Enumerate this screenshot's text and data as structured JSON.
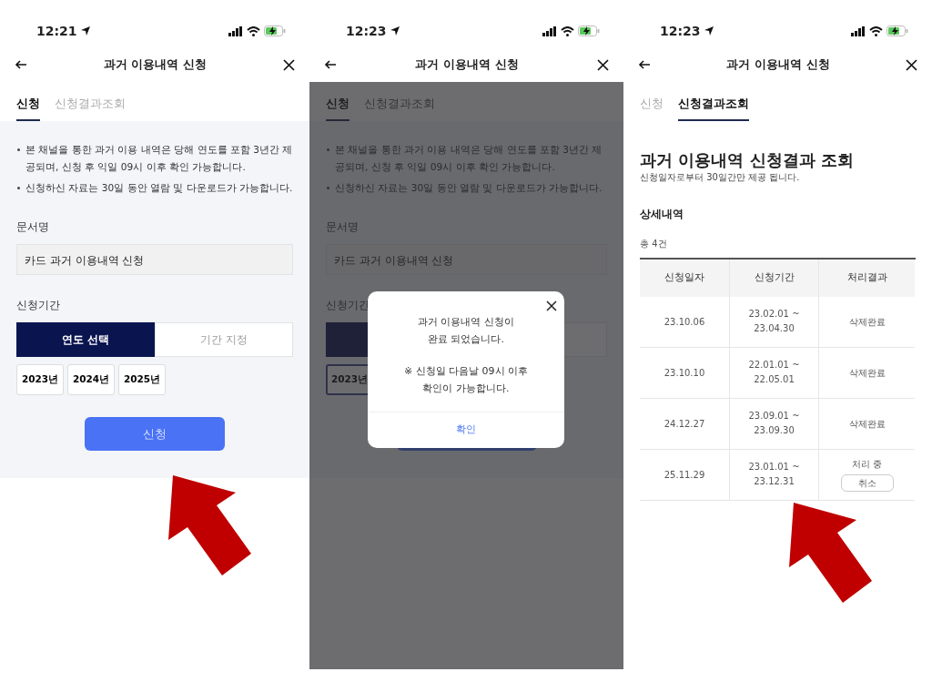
{
  "screens": [
    {
      "kind": "form",
      "status_bar": {
        "time": "12:21"
      },
      "header": {
        "title": "과거 이용내역 신청"
      },
      "tabs": [
        {
          "label": "신청",
          "selected": true
        },
        {
          "label": "신청결과조회",
          "selected": false
        }
      ],
      "notices": [
        "본 채널을 통한 과거 이용 내역은 당해 연도를 포함 3년간 제공되며, 신청 후 익일 09시 이후 확인 가능합니다.",
        "신청하신 자료는 30일 동안 열람 및 다운로드가 가능합니다."
      ],
      "document": {
        "label": "문서명",
        "value": "카드 과거 이용내역 신청"
      },
      "period": {
        "label": "신청기간",
        "modes": [
          {
            "label": "연도 선택",
            "selected": true
          },
          {
            "label": "기간 지정",
            "selected": false
          }
        ],
        "years": [
          {
            "label": "2023년",
            "selected": false
          },
          {
            "label": "2024년",
            "selected": false
          },
          {
            "label": "2025년",
            "selected": false
          }
        ]
      },
      "submit": {
        "label": "신청"
      }
    },
    {
      "kind": "form",
      "status_bar": {
        "time": "12:23"
      },
      "header": {
        "title": "과거 이용내역 신청"
      },
      "tabs": [
        {
          "label": "신청",
          "selected": true
        },
        {
          "label": "신청결과조회",
          "selected": false
        }
      ],
      "notices": [
        "본 채널을 통한 과거 이용 내역은 당해 연도를 포함 3년간 제공되며, 신청 후 익일 09시 이후 확인 가능합니다.",
        "신청하신 자료는 30일 동안 열람 및 다운로드가 가능합니다."
      ],
      "document": {
        "label": "문서명",
        "value": "카드 과거 이용내역 신청"
      },
      "period": {
        "label": "신청기간",
        "modes": [
          {
            "selected": true
          },
          {
            "selected": false
          }
        ],
        "years": [
          {
            "label": "2023년",
            "selected": true
          }
        ]
      },
      "dialog": {
        "messages": [
          "과거 이용내역 신청이\n완료 되었습니다.",
          "※ 신청일 다음날 09시 이후\n확인이 가능합니다."
        ],
        "confirm": "확인"
      }
    },
    {
      "kind": "results",
      "status_bar": {
        "time": "12:23"
      },
      "header": {
        "title": "과거 이용내역 신청"
      },
      "tabs": [
        {
          "label": "신청",
          "selected": false
        },
        {
          "label": "신청결과조회",
          "selected": true
        }
      ],
      "title": "과거 이용내역 신청결과 조회",
      "subtitle": "신청일자로부터 30일간만 제공 됩니다.",
      "section": "상세내역",
      "count": "총 4건",
      "table": {
        "columns": [
          "신청일자",
          "신청기간",
          "처리결과"
        ],
        "rows": [
          {
            "date": "23.10.06",
            "period": "23.02.01 ~ 23.04.30",
            "status": "삭제완료"
          },
          {
            "date": "23.10.10",
            "period": "22.01.01 ~ 22.05.01",
            "status": "삭제완료"
          },
          {
            "date": "24.12.27",
            "period": "23.09.01 ~ 23.09.30",
            "status": "삭제완료"
          },
          {
            "date": "25.11.29",
            "period": "23.01.01 ~ 23.12.31",
            "status": "처리 중",
            "action": "취소"
          }
        ]
      }
    }
  ]
}
